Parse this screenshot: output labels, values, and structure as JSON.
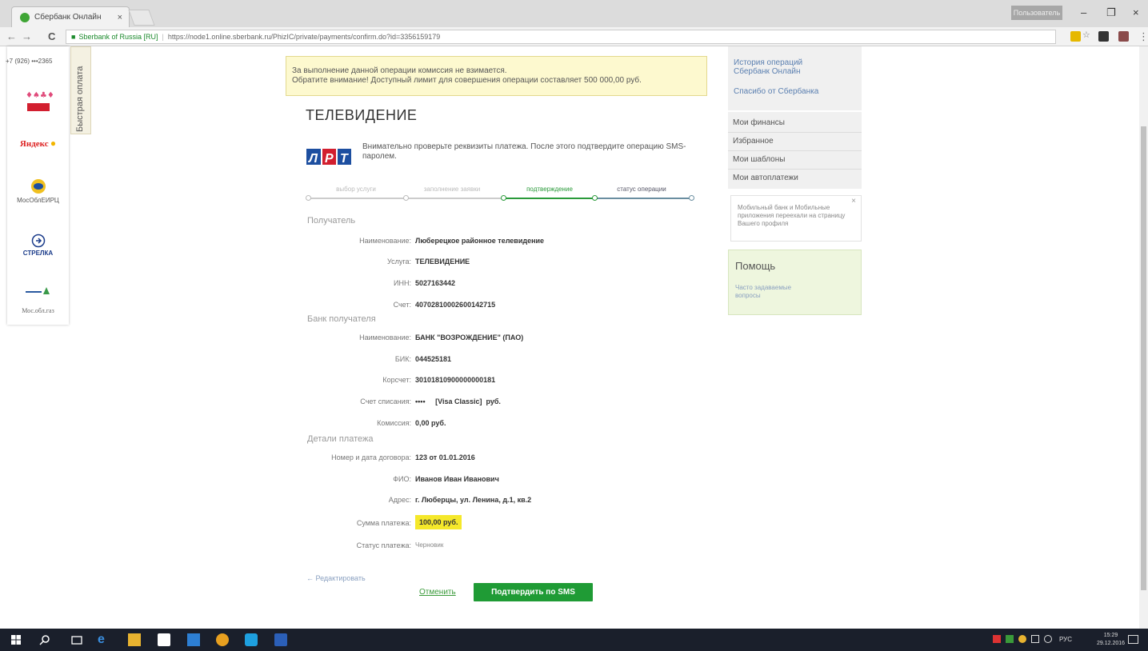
{
  "browser": {
    "tab_title": "Сбербанк Онлайн",
    "tab_close": "×",
    "user_badge": "Пользователь",
    "win_minimize": "–",
    "win_restore": "❐",
    "win_close": "×",
    "back": "←",
    "forward": "→",
    "reload": "C",
    "site_label": "Sberbank of Russia [RU]",
    "url": "https://node1.online.sberbank.ru/PhizIC/private/payments/confirm.do?id=3356159179"
  },
  "left": {
    "phone": "+7 (926) •••2365",
    "partners": [
      "Мосэнерго",
      "Яндекс",
      "МосОблЕИРЦ",
      "СТРЕЛКА",
      "Мосэнергосбыт",
      "Мос.обл.газ"
    ],
    "quick_tab": "Быстрая оплата"
  },
  "notice": {
    "line1": "За выполнение данной операции комиссия не взимается.",
    "line2": "Обратите внимание! Доступный лимит для совершения операции составляет 500 000,00 руб."
  },
  "page_title": "ТЕЛЕВИДЕНИЕ",
  "hint": "Внимательно проверьте реквизиты платежа. После этого подтвердите операцию SMS-паролем.",
  "progress": {
    "steps": [
      "выбор услуги",
      "заполнение заявки",
      "подтверждение",
      "статус операции"
    ],
    "active_index": 2
  },
  "sections": {
    "recipient": "Получатель",
    "bank": "Банк получателя",
    "details": "Детали платежа"
  },
  "fields": {
    "recipient": [
      {
        "label": "Наименование:",
        "value": "Люберецкое районное телевидение"
      },
      {
        "label": "Услуга:",
        "value": "ТЕЛЕВИДЕНИЕ"
      },
      {
        "label": "ИНН:",
        "value": "5027163442"
      },
      {
        "label": "Счет:",
        "value": "40702810002600142715"
      }
    ],
    "bank": [
      {
        "label": "Наименование:",
        "value": "БАНК \"ВОЗРОЖДЕНИЕ\" (ПАО)"
      },
      {
        "label": "БИК:",
        "value": "044525181"
      },
      {
        "label": "Корсчет:",
        "value": "30101810900000000181"
      },
      {
        "label": "Счет списания:",
        "value": "••••     [Visa Classic]  руб."
      },
      {
        "label": "Комиссия:",
        "value": "0,00 руб."
      }
    ],
    "details": [
      {
        "label": "Номер и дата договора:",
        "value": "123 от 01.01.2016"
      },
      {
        "label": "ФИО:",
        "value": "Иванов Иван Иванович"
      },
      {
        "label": "Адрес:",
        "value": "г. Люберцы, ул. Ленина, д.1, кв.2"
      },
      {
        "label": "Сумма платежа:",
        "value": "100,00 руб."
      },
      {
        "label": "Статус платежа:",
        "value": "Черновик"
      }
    ]
  },
  "actions": {
    "edit": "← Редактировать",
    "cancel": "Отменить",
    "confirm": "Подтвердить по SMS"
  },
  "sidebar": {
    "history": "История операций Сбербанк Онлайн",
    "spasibo": "Спасибо от Сбербанка",
    "menu": [
      "Мои финансы",
      "Избранное",
      "Мои шаблоны",
      "Мои автоплатежи"
    ],
    "info": "Мобильный банк и Мобильные приложения переехали на страницу Вашего профиля",
    "info_close": "×",
    "help_title": "Помощь",
    "help_faq": "Часто задаваемые вопросы"
  },
  "taskbar": {
    "lang": "РУС",
    "time": "15:29",
    "date": "29.12.2016"
  },
  "colors": {
    "accent_green": "#1f9b35",
    "notice_bg": "#fdf9cf",
    "highlight": "#f5e82a"
  }
}
